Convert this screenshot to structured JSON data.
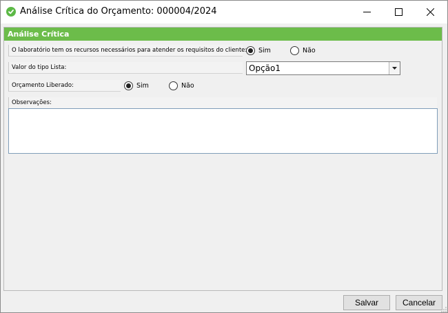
{
  "window": {
    "title": "Análise Crítica do Orçamento: 000004/2024",
    "app_icon": "check-circle-icon",
    "controls": [
      "minimize-icon",
      "maximize-icon",
      "close-icon"
    ]
  },
  "section": {
    "title": "Análise Crítica"
  },
  "fields": {
    "recursos": {
      "label": "O laboratório tem os recursos necessários para atender os requisitos do cliente:",
      "options": [
        "Sim",
        "Não"
      ],
      "selected": "Sim"
    },
    "lista": {
      "label": "Valor do tipo Lista:",
      "value": "Opção1"
    },
    "liberado": {
      "label": "Orçamento Liberado:",
      "options": [
        "Sim",
        "Não"
      ],
      "selected": "Sim"
    },
    "observacoes": {
      "label": "Observações:",
      "value": ""
    }
  },
  "footer": {
    "save_label": "Salvar",
    "cancel_label": "Cancelar"
  },
  "colors": {
    "section_header": "#6cbc4a",
    "app_icon": "#5cb946"
  }
}
